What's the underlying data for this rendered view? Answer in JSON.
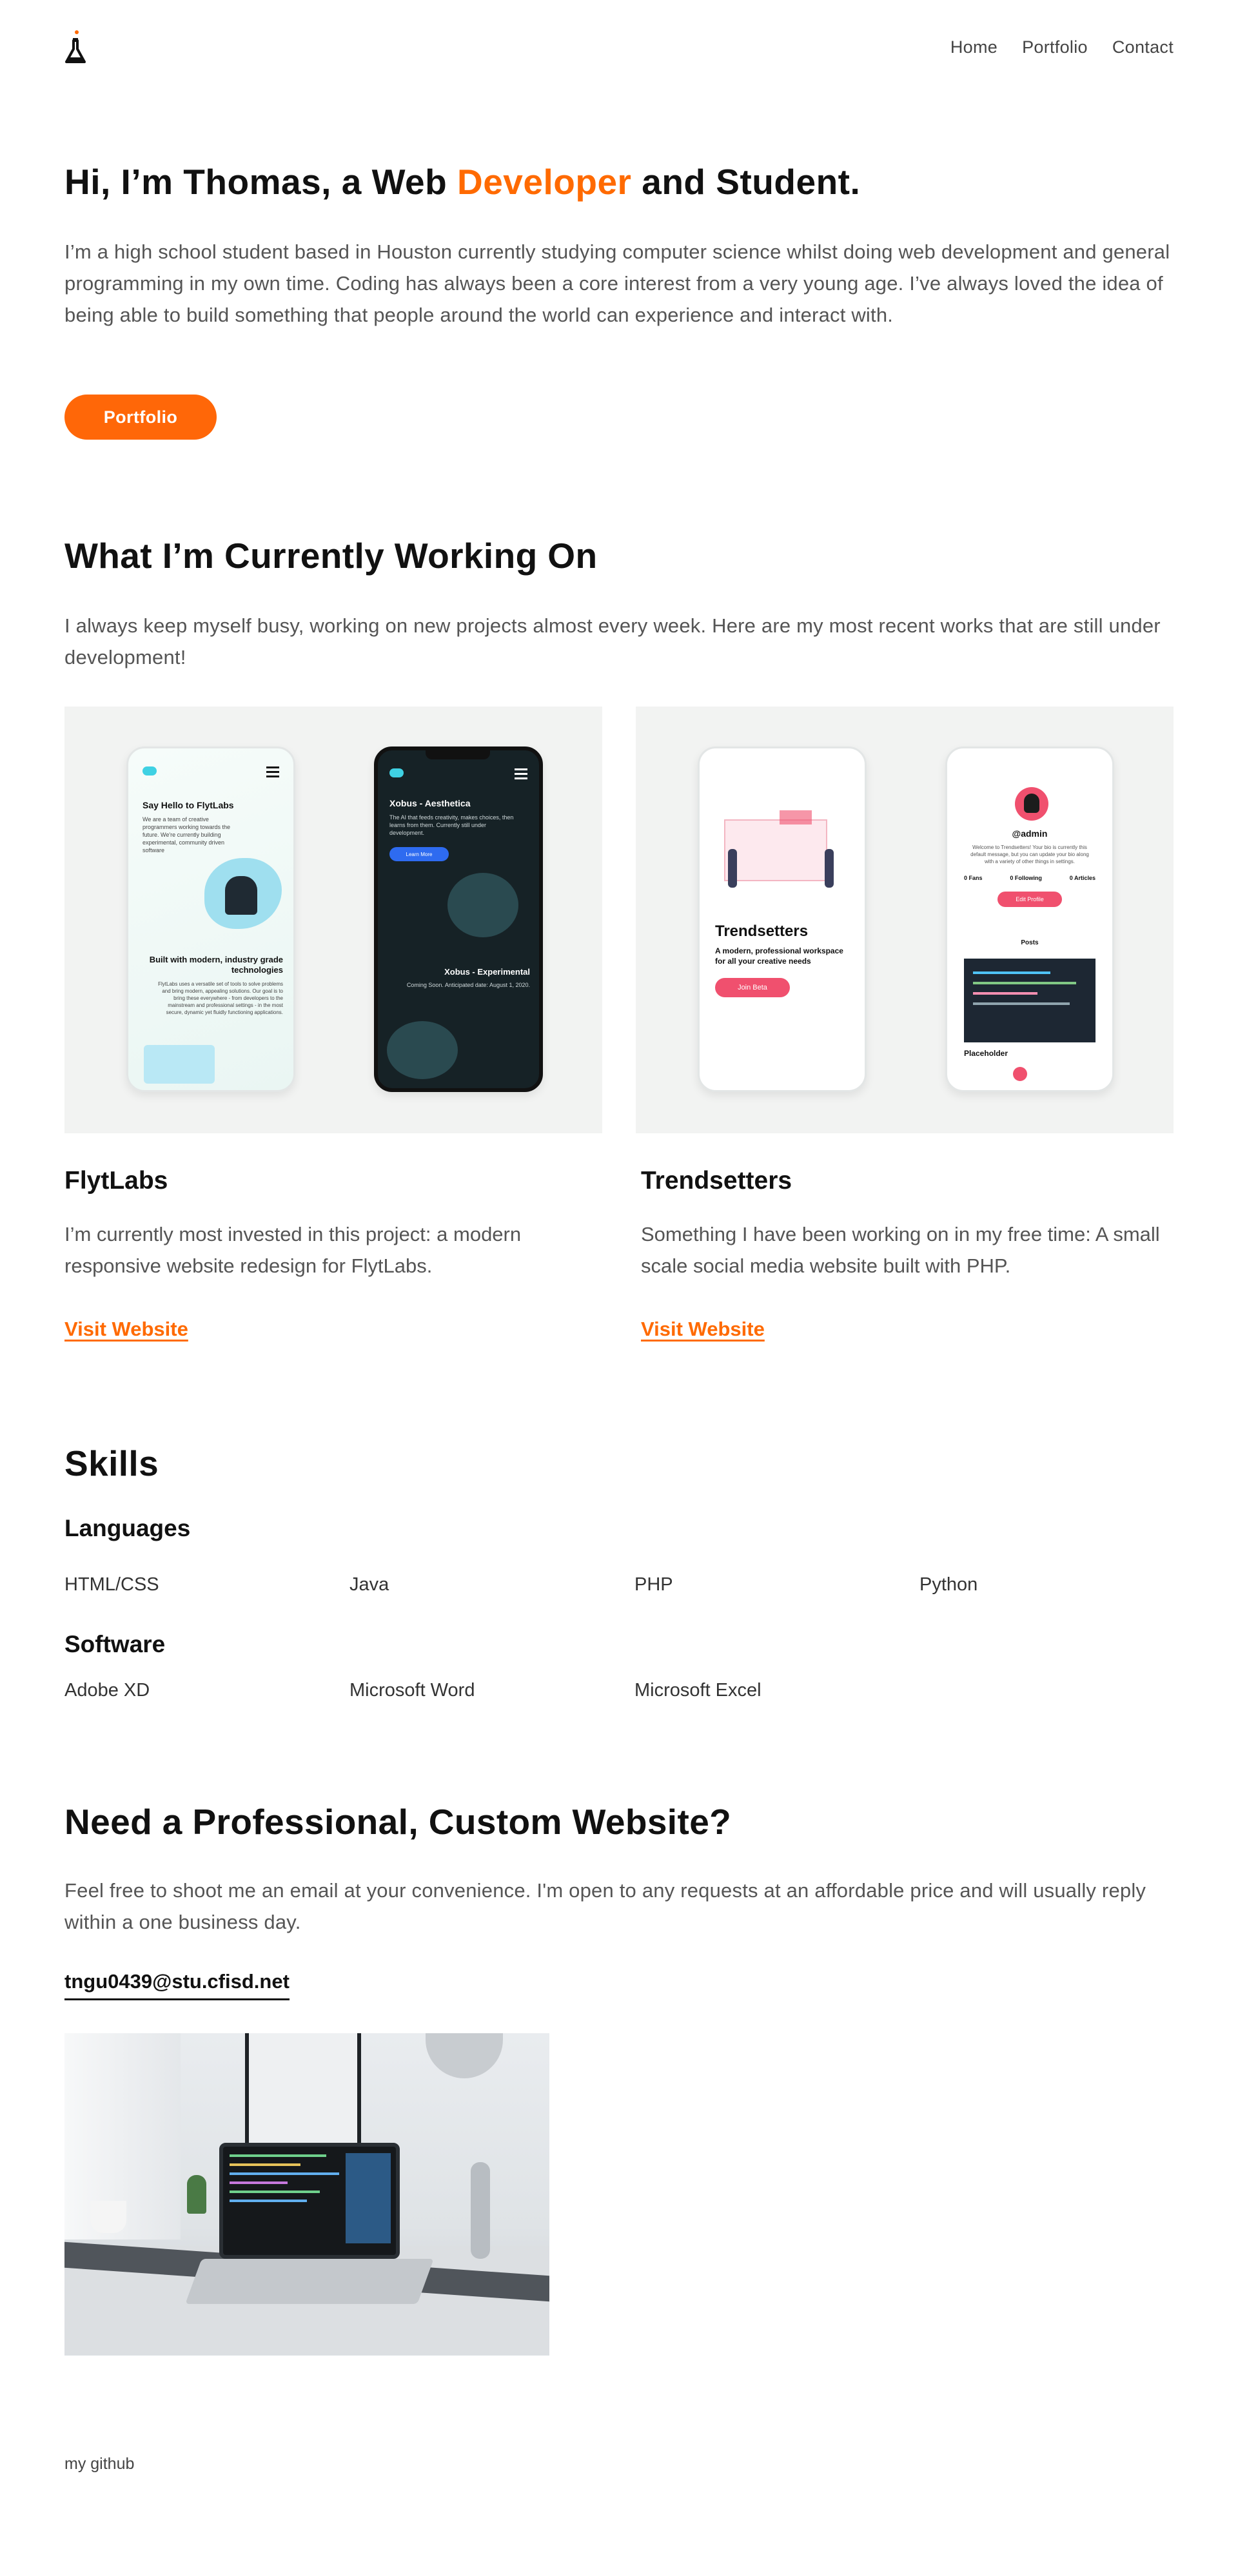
{
  "header": {
    "logo": "flask-logo",
    "nav": [
      "Home",
      "Portfolio",
      "Contact"
    ]
  },
  "hero": {
    "title_pre": "Hi, I’m Thomas, a Web ",
    "title_accent": "Developer",
    "title_post": " and Student.",
    "paragraph": "I’m a high school student based in Houston currently studying computer science whilst doing web development and general programming in my own time. Coding has always been a core interest from a very young age. I’ve always loved the idea of being able to build something that people around the world can experience and interact with.",
    "button": "Portfolio"
  },
  "working": {
    "title": "What I’m Currently Working On",
    "paragraph": "I always keep myself busy, working on new projects almost every week. Here are my most recent works that are still under development!",
    "projects": [
      {
        "title": "FlytLabs",
        "description": "I’m currently most invested in this project: a modern responsive website redesign for FlytLabs.",
        "link": "Visit Website",
        "mock": {
          "left_heading": "Say Hello to FlytLabs",
          "left_text": "We are a team of creative programmers working towards the future. We're currently building experimental, community driven software",
          "left_heading2": "Built with modern, industry grade technologies",
          "left_text2": "FlytLabs uses a versatile set of tools to solve problems and bring modern, appealing solutions. Our goal is to bring these everywhere - from developers to the mainstream and professional settings - in the most secure, dynamic yet fluidly functioning applications.",
          "right_heading": "Xobus - Aesthetica",
          "right_text": "The AI that feeds creativity, makes choices, then learns from them. Currently still under development.",
          "right_button": "Learn More",
          "right_heading2": "Xobus - Experimental",
          "right_text2": "Coming Soon. Anticipated date: August 1, 2020."
        }
      },
      {
        "title": "Trendsetters",
        "description": "Something I have been working on in my free time: A small scale social media website built with PHP.",
        "link": "Visit Website",
        "mock": {
          "left_heading": "Trendsetters",
          "left_text": "A modern, professional workspace for all your creative needs",
          "left_button": "Join Beta",
          "right_user": "@admin",
          "right_text": "Welcome to Trendsetters! Your bio is currently this default message, but you can update your bio along with a variety of other things in settings.",
          "right_stats": [
            "0 Fans",
            "0 Following",
            "0 Articles"
          ],
          "right_button": "Edit Profile",
          "right_posts": "Posts",
          "right_placeholder": "Placeholder"
        }
      }
    ]
  },
  "skills": {
    "title": "Skills",
    "languages_title": "Languages",
    "languages": [
      "HTML/CSS",
      "Java",
      "PHP",
      "Python"
    ],
    "software_title": "Software",
    "software": [
      "Adobe XD",
      "Microsoft Word",
      "Microsoft Excel"
    ]
  },
  "contact": {
    "title": "Need a Professional, Custom Website?",
    "paragraph": "Feel free to shoot me an email at your convenience. I'm open to any requests at an affordable price and will usually reply within a one business day.",
    "email": "tngu0439@stu.cfisd.net"
  },
  "footer": {
    "link": "my github"
  },
  "colors": {
    "accent": "#ff6a00",
    "text": "#111111",
    "muted": "#555555",
    "card_bg": "#f2f3f2",
    "trend_pink": "#f0506e"
  }
}
